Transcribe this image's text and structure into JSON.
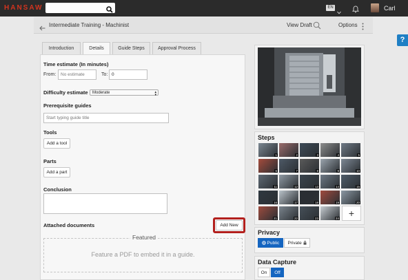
{
  "app": {
    "logo": "HANSAW",
    "lang": "EN",
    "user": "Carl"
  },
  "header": {
    "title": "Intermediate Training - Machinist",
    "view_draft": "View Draft",
    "options": "Options"
  },
  "help": "?",
  "tabs": [
    "Introduction",
    "Details",
    "Guide Steps",
    "Approval Process"
  ],
  "details": {
    "time_heading": "Time estimate (In minutes)",
    "from_label": "From:",
    "from_placeholder": "No estimate",
    "to_label": "To:",
    "to_value": "0",
    "difficulty_label": "Difficulty estimate",
    "difficulty_value": "Moderate",
    "prereq_heading": "Prerequisite guides",
    "prereq_placeholder": "Start typing guide title",
    "tools_heading": "Tools",
    "add_tool": "Add a tool",
    "parts_heading": "Parts",
    "add_part": "Add a part",
    "conclusion_heading": "Conclusion",
    "attached_heading": "Attached documents",
    "add_new": "Add New",
    "featured_title": "Featured",
    "featured_text": "Feature a PDF to embed it in a guide."
  },
  "steps": {
    "heading": "Steps",
    "add_icon": "plus-icon",
    "thumbs": [
      {
        "n": "1",
        "c": "#7b8792"
      },
      {
        "n": "2",
        "c": "#9a6b6b"
      },
      {
        "n": "3",
        "c": "#3d4a57"
      },
      {
        "n": "4",
        "c": "#8d8d8d"
      },
      {
        "n": "5",
        "c": "#6f7a86"
      },
      {
        "n": "6",
        "c": "#a44b3c"
      },
      {
        "n": "7",
        "c": "#4d5966"
      },
      {
        "n": "8",
        "c": "#5a5a5a"
      },
      {
        "n": "9",
        "c": "#9aa4ad"
      },
      {
        "n": "10",
        "c": "#7d8894"
      },
      {
        "n": "11",
        "c": "#5d6873"
      },
      {
        "n": "12",
        "c": "#8e99a3"
      },
      {
        "n": "13",
        "c": "#3a444d"
      },
      {
        "n": "14",
        "c": "#6c7884"
      },
      {
        "n": "15",
        "c": "#4e5b68"
      },
      {
        "n": "16",
        "c": "#2f3840"
      },
      {
        "n": "17",
        "c": "#b9c2c9"
      },
      {
        "n": "18",
        "c": "#2a2e33"
      },
      {
        "n": "19",
        "c": "#a04a3e"
      },
      {
        "n": "20",
        "c": "#8b98a3"
      },
      {
        "n": "21",
        "c": "#9d4b3e"
      },
      {
        "n": "22",
        "c": "#7a848d"
      },
      {
        "n": "23",
        "c": "#454f58"
      },
      {
        "n": "24",
        "c": "#c6ccd1"
      }
    ]
  },
  "privacy": {
    "heading": "Privacy",
    "public": "Public",
    "private": "Private"
  },
  "capture": {
    "heading": "Data Capture",
    "on": "On",
    "off": "Off"
  },
  "colors": {
    "accent": "#1565c0",
    "highlight": "#b3201d",
    "logo": "#d2341f"
  }
}
